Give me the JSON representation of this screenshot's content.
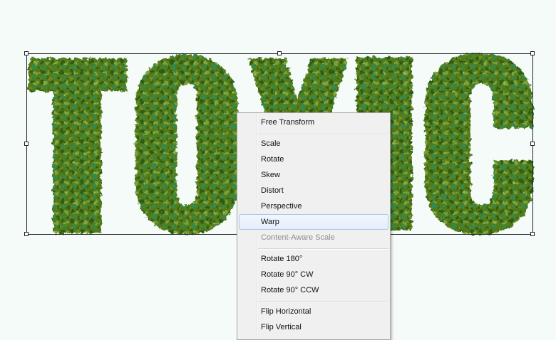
{
  "artwork": {
    "text": "TOXIC",
    "colors": {
      "grass_dark": "#2f5a12",
      "grass_mid": "#4f7d1c",
      "grass_light": "#7fa03a",
      "grass_blue": "#2e8c5a",
      "grass_olive": "#8a8a1e"
    }
  },
  "context_menu": {
    "free_transform": "Free Transform",
    "scale": "Scale",
    "rotate": "Rotate",
    "skew": "Skew",
    "distort": "Distort",
    "perspective": "Perspective",
    "warp": "Warp",
    "content_aware_scale": "Content-Aware Scale",
    "rotate_180": "Rotate 180°",
    "rotate_90_cw": "Rotate 90° CW",
    "rotate_90_ccw": "Rotate 90° CCW",
    "flip_horizontal": "Flip Horizontal",
    "flip_vertical": "Flip Vertical"
  }
}
